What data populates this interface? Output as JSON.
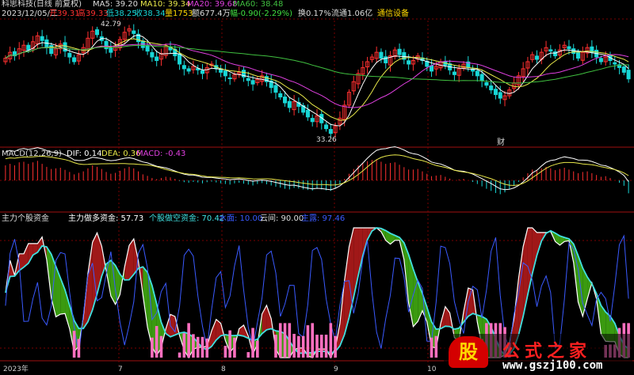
{
  "colors": {
    "up": "#ff3030",
    "down": "#18d6d6",
    "ma5": "#ffffff",
    "ma10": "#e8e84a",
    "ma20": "#e040e0",
    "ma60": "#40c040",
    "dif": "#ffffff",
    "dea": "#e8e84a",
    "grid": "#7a0000",
    "bullish_fill": "#a01818",
    "bearish_fill": "#3a9a10",
    "water_line": "#3a5aff",
    "main_force": "#ff70c0"
  },
  "header": {
    "stock": "科思科技(日线 前复权)",
    "ma5": "MA5: 39.20",
    "ma10": "MA10: 39.34",
    "ma20": "MA20: 39.68",
    "ma60": "MA60: 38.48"
  },
  "info_bar": {
    "date": "2023/12/05/二",
    "open": "开39.31",
    "high": "高39.33",
    "low": "低38.25",
    "close": "收38.34",
    "volume": "量1753",
    "amount": "额677.4万",
    "change": "幅-0.90(-2.29%)",
    "turnover": "换0.17%",
    "float": "流通1.06亿",
    "sector": "通信设备"
  },
  "price_annotations": {
    "high": "42.79",
    "low": "33.26",
    "fin_marker": "财"
  },
  "macd": {
    "title": "MACD(12,26,9)",
    "dif": "DIF: 0.14",
    "dea": "DEA: 0.36",
    "macd": "MACD: -0.43"
  },
  "indicator": {
    "title": "主力个股资金",
    "bull": "主力做多资金: 57.73",
    "bear": "个股做空资金: 70.42",
    "water": "水面: 10.00",
    "cloud": "云间: 90.00",
    "main": "主露: 97.46"
  },
  "xaxis": {
    "year": "2023年",
    "m7": "7",
    "m8": "8",
    "m9": "9",
    "m10": "10"
  },
  "watermark": {
    "gu": "股",
    "brand": "公式之家",
    "url": "www.gszj100.com"
  },
  "chart_data": {
    "type": "candlestick",
    "closes": [
      40.1,
      40.6,
      40.3,
      40.9,
      41.2,
      40.8,
      41.5,
      42.0,
      41.6,
      41.0,
      40.5,
      40.9,
      41.3,
      40.7,
      40.2,
      39.8,
      40.4,
      41.0,
      41.8,
      42.4,
      42.1,
      41.6,
      40.9,
      40.6,
      41.1,
      41.7,
      42.3,
      42.6,
      42.2,
      41.5,
      41.0,
      40.7,
      40.2,
      39.9,
      40.5,
      41.1,
      40.8,
      40.3,
      39.6,
      39.2,
      39.0,
      39.4,
      39.1,
      38.8,
      39.3,
      39.6,
      39.2,
      38.9,
      38.6,
      38.4,
      38.7,
      38.9,
      38.5,
      38.2,
      37.9,
      38.3,
      38.6,
      38.1,
      37.6,
      37.2,
      36.8,
      36.3,
      35.9,
      36.4,
      36.0,
      35.5,
      35.1,
      34.7,
      35.2,
      34.6,
      34.1,
      33.7,
      34.3,
      35.0,
      36.1,
      37.2,
      38.1,
      38.8,
      39.3,
      39.8,
      40.2,
      40.6,
      40.1,
      39.7,
      40.3,
      40.8,
      40.4,
      40.0,
      39.6,
      39.9,
      40.3,
      39.9,
      39.4,
      39.0,
      39.4,
      39.8,
      39.5,
      39.1,
      38.7,
      39.2,
      39.6,
      39.3,
      39.0,
      38.6,
      38.2,
      37.8,
      37.4,
      37.0,
      36.7,
      36.9,
      37.4,
      38.0,
      38.6,
      39.2,
      39.8,
      40.4,
      40.0,
      40.6,
      41.0,
      40.7,
      40.3,
      40.8,
      41.2,
      40.9,
      40.5,
      40.1,
      40.6,
      41.0,
      40.6,
      40.2,
      39.8,
      40.2,
      39.9,
      39.6,
      39.3,
      38.9,
      38.34
    ],
    "macd_hist": [
      0.5,
      0.55,
      0.5,
      0.6,
      0.62,
      0.55,
      0.6,
      0.65,
      0.55,
      0.45,
      0.38,
      0.4,
      0.42,
      0.35,
      0.28,
      0.2,
      0.25,
      0.3,
      0.4,
      0.5,
      0.45,
      0.38,
      0.28,
      0.22,
      0.25,
      0.32,
      0.4,
      0.45,
      0.4,
      0.3,
      0.2,
      0.15,
      0.08,
      0.04,
      0.08,
      0.12,
      0.1,
      0.05,
      -0.02,
      -0.06,
      -0.08,
      -0.05,
      -0.07,
      -0.1,
      -0.06,
      -0.04,
      -0.07,
      -0.1,
      -0.12,
      -0.14,
      -0.1,
      -0.08,
      -0.11,
      -0.14,
      -0.17,
      -0.12,
      -0.09,
      -0.13,
      -0.17,
      -0.21,
      -0.24,
      -0.28,
      -0.3,
      -0.25,
      -0.27,
      -0.3,
      -0.32,
      -0.34,
      -0.28,
      -0.3,
      -0.33,
      -0.35,
      -0.25,
      -0.12,
      0.05,
      0.22,
      0.38,
      0.5,
      0.58,
      0.64,
      0.68,
      0.7,
      0.62,
      0.55,
      0.58,
      0.6,
      0.52,
      0.44,
      0.36,
      0.36,
      0.38,
      0.3,
      0.22,
      0.14,
      0.16,
      0.18,
      0.12,
      0.06,
      0.0,
      0.03,
      0.05,
      0.0,
      -0.05,
      -0.12,
      -0.2,
      -0.28,
      -0.35,
      -0.42,
      -0.46,
      -0.4,
      -0.3,
      -0.18,
      -0.05,
      0.1,
      0.24,
      0.36,
      0.32,
      0.4,
      0.45,
      0.4,
      0.34,
      0.38,
      0.42,
      0.36,
      0.3,
      0.24,
      0.28,
      0.3,
      0.24,
      0.18,
      0.12,
      0.14,
      0.08,
      0.0,
      -0.08,
      -0.18,
      -0.43
    ]
  }
}
